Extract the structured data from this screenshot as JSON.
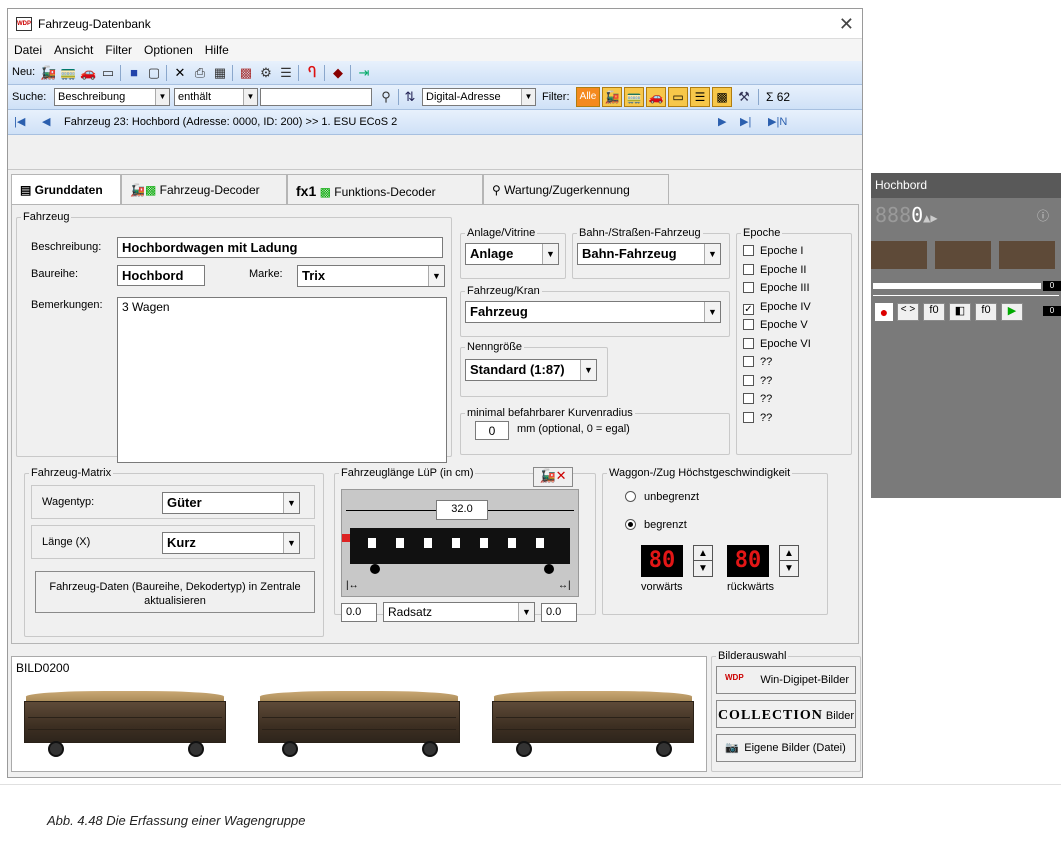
{
  "window": {
    "title": "Fahrzeug-Datenbank"
  },
  "menu": [
    "Datei",
    "Ansicht",
    "Filter",
    "Optionen",
    "Hilfe"
  ],
  "toolbar": {
    "neu_label": "Neu:"
  },
  "search": {
    "label": "Suche:",
    "field": "Beschreibung",
    "op": "enthält",
    "value": "",
    "sort": "Digital-Adresse",
    "filter_label": "Filter:",
    "filter_all": "Alle",
    "sum_label": "Σ 62"
  },
  "nav": {
    "text": "Fahrzeug 23: Hochbord (Adresse: 0000, ID: 200) >> 1. ESU ECoS 2"
  },
  "tabs": [
    "Grunddaten",
    "Fahrzeug-Decoder",
    "fx1",
    "Funktions-Decoder",
    "Wartung/Zugerkennung"
  ],
  "fahrzeug": {
    "legend": "Fahrzeug",
    "beschreibung_label": "Beschreibung:",
    "beschreibung": "Hochbordwagen mit Ladung",
    "baureihe_label": "Baureihe:",
    "baureihe": "Hochbord",
    "marke_label": "Marke:",
    "marke": "Trix",
    "bemerkungen_label": "Bemerkungen:",
    "bemerkungen": "3 Wagen"
  },
  "anlage": {
    "legend": "Anlage/Vitrine",
    "value": "Anlage"
  },
  "bahn": {
    "legend": "Bahn-/Straßen-Fahrzeug",
    "value": "Bahn-Fahrzeug"
  },
  "kran": {
    "legend": "Fahrzeug/Kran",
    "value": "Fahrzeug"
  },
  "nenn": {
    "legend": "Nenngröße",
    "value": "Standard (1:87)"
  },
  "kurve": {
    "legend": "minimal befahrbarer Kurvenradius",
    "value": "0",
    "hint": "mm (optional, 0 = egal)"
  },
  "epoche": {
    "legend": "Epoche",
    "items": [
      {
        "label": "Epoche I",
        "checked": false
      },
      {
        "label": "Epoche II",
        "checked": false
      },
      {
        "label": "Epoche III",
        "checked": false
      },
      {
        "label": "Epoche IV",
        "checked": true
      },
      {
        "label": "Epoche V",
        "checked": false
      },
      {
        "label": "Epoche VI",
        "checked": false
      },
      {
        "label": "??",
        "checked": false
      },
      {
        "label": "??",
        "checked": false
      },
      {
        "label": "??",
        "checked": false
      },
      {
        "label": "??",
        "checked": false
      }
    ]
  },
  "matrix": {
    "legend": "Fahrzeug-Matrix",
    "wagentyp_label": "Wagentyp:",
    "wagentyp": "Güter",
    "laenge_label": "Länge (X)",
    "laenge": "Kurz"
  },
  "update_button": "Fahrzeug-Daten (Baureihe, Dekodertyp) in Zentrale aktualisieren",
  "laenge": {
    "legend": "Fahrzeuglänge LüP (in cm)",
    "value": "32.0",
    "left": "0.0",
    "right": "0.0",
    "radsatz": "Radsatz"
  },
  "speed": {
    "legend": "Waggon-/Zug Höchstgeschwindigkeit",
    "unbegrenzt": "unbegrenzt",
    "begrenzt": "begrenzt",
    "fwd": "80",
    "rev": "80",
    "fwd_label": "vorwärts",
    "rev_label": "rückwärts"
  },
  "bild": {
    "name": "BILD0200",
    "legend": "Bilderauswahl",
    "btn1": "Win-Digipet-Bilder",
    "btn2_logo": "COLLECTION",
    "btn2": "Bilder",
    "btn3": "Eigene Bilder (Datei)"
  },
  "hochbord": {
    "title": "Hochbord",
    "digits": "888",
    "speed": "0",
    "fn1": "f0",
    "fn2": "f0",
    "lvl1": "0",
    "lvl2": "0"
  },
  "caption": "Abb. 4.48    Die Erfassung einer Wagengruppe"
}
